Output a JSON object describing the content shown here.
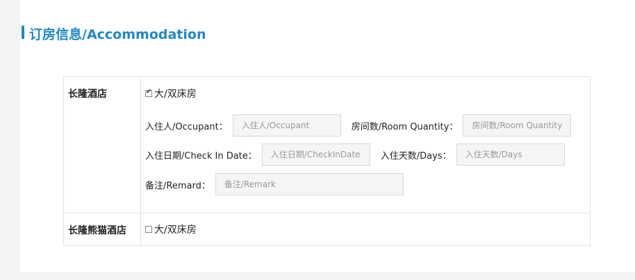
{
  "section": {
    "title": "订房信息/Accommodation",
    "accent_color": "#1e88c8"
  },
  "hotels": [
    {
      "name": "长隆酒店",
      "room_type": "大/双床房",
      "room_checked": true,
      "fields": {
        "occupant_label": "入住人/Occupant：",
        "occupant_placeholder": "入住人/Occupant",
        "room_qty_label": "房间数/Room Quantity：",
        "room_qty_placeholder": "房间数/Room Quantity",
        "checkin_label": "入住日期/Check In Date：",
        "checkin_placeholder": "入住日期/CheckInDate",
        "days_label": "入住天数/Days：",
        "days_placeholder": "入住天数/Days",
        "remark_label": "备注/Remard：",
        "remark_placeholder": "备注/Remark"
      }
    },
    {
      "name": "长隆熊猫酒店",
      "room_type": "大/双床房",
      "room_checked": false
    }
  ]
}
